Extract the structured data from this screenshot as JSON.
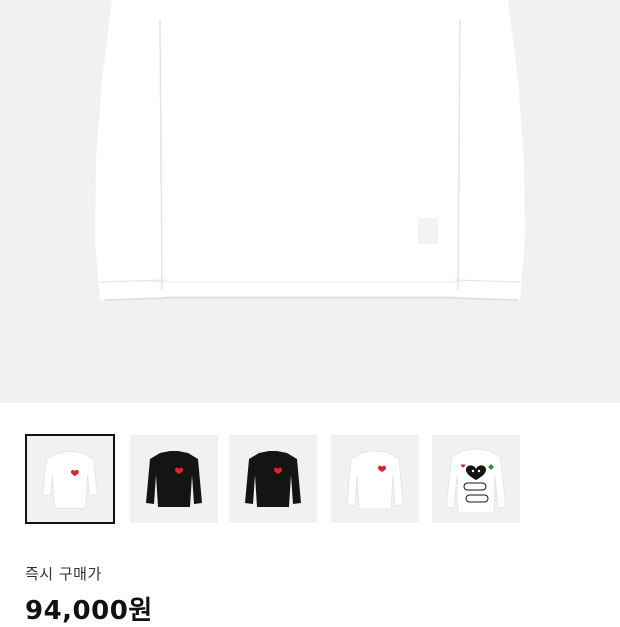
{
  "product": {
    "hero_image": "white-long-sleeve-tshirt",
    "thumbnails": [
      {
        "name": "white-heart-longsleeve",
        "color": "#ffffff",
        "selected": true
      },
      {
        "name": "black-heart-longsleeve",
        "color": "#111111",
        "selected": false
      },
      {
        "name": "black-heart-longsleeve-alt",
        "color": "#111111",
        "selected": false
      },
      {
        "name": "white-heart-longsleeve-alt",
        "color": "#ffffff",
        "selected": false
      },
      {
        "name": "white-graphic-longsleeve",
        "color": "#ffffff",
        "selected": false
      }
    ]
  },
  "purchase": {
    "label": "즉시 구매가",
    "price": "94,000원"
  },
  "colors": {
    "background": "#f1f1f1",
    "heart": "#e0242b",
    "text": "#111111"
  }
}
